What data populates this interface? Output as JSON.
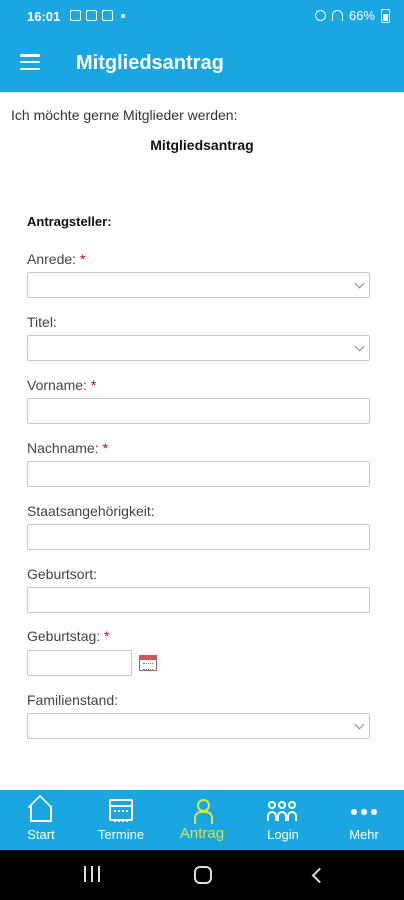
{
  "status_bar": {
    "time": "16:01",
    "battery": "66%"
  },
  "app_bar": {
    "title": "Mitgliedsantrag",
    "menu_icon": "hamburger-menu-icon"
  },
  "content": {
    "intro": "Ich möchte gerne Mitglieder werden:",
    "subtitle": "Mitgliedsantrag",
    "section_heading": "Antragsteller:"
  },
  "form": {
    "anrede": {
      "label": "Anrede:",
      "required": "*",
      "value": ""
    },
    "titel": {
      "label": "Titel:",
      "value": ""
    },
    "vorname": {
      "label": "Vorname:",
      "required": "*",
      "value": ""
    },
    "nachname": {
      "label": "Nachname:",
      "required": "*",
      "value": ""
    },
    "staatsangehoerigkeit": {
      "label": "Staatsangehörigkeit:",
      "value": ""
    },
    "geburtsort": {
      "label": "Geburtsort:",
      "value": ""
    },
    "geburtstag": {
      "label": "Geburtstag:",
      "required": "*",
      "value": ""
    },
    "familienstand": {
      "label": "Familienstand:",
      "value": ""
    }
  },
  "bottom_nav": {
    "items": [
      {
        "label": "Start",
        "icon": "home-icon"
      },
      {
        "label": "Termine",
        "icon": "calendar-icon"
      },
      {
        "label": "Antrag",
        "icon": "person-icon",
        "active": true
      },
      {
        "label": "Login",
        "icon": "group-icon"
      },
      {
        "label": "Mehr",
        "icon": "more-icon"
      }
    ]
  },
  "colors": {
    "primary": "#1aa6e0",
    "active_nav": "#d4e64a",
    "required": "#d0021b"
  }
}
